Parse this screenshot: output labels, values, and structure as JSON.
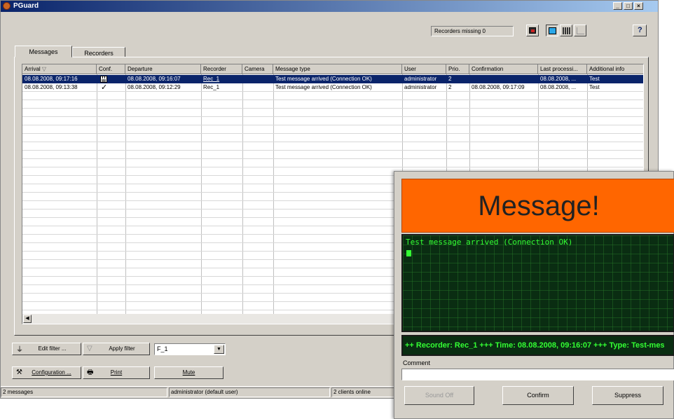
{
  "window": {
    "title": "PGuard",
    "controls": [
      "minimize-icon",
      "restore-icon",
      "close-icon"
    ]
  },
  "toolbar": {
    "recorders_missing": "Recorders missing 0",
    "help_label": "?"
  },
  "tabs": [
    {
      "label": "Messages",
      "active": true
    },
    {
      "label": "Recorders",
      "active": false
    }
  ],
  "grid": {
    "columns": [
      "Arrival",
      "Conf.",
      "Departure",
      "Recorder",
      "Camera",
      "Message type",
      "User",
      "Prio.",
      "Confirmation",
      "Last processi...",
      "Additional info"
    ],
    "rows": [
      {
        "arrival": "08.08.2008, 09:17:16",
        "conf": "lock",
        "departure": "08.08.2008, 09:16:07",
        "recorder": "Rec_1",
        "camera": "",
        "message_type": "Test message arrived (Connection OK)",
        "user": "administrator",
        "prio": "2",
        "confirmation": "",
        "last_processing": "08.08.2008, ...",
        "additional_info": "Test",
        "selected": true
      },
      {
        "arrival": "08.08.2008, 09:13:38",
        "conf": "✓",
        "departure": "08.08.2008, 09:12:29",
        "recorder": "Rec_1",
        "camera": "",
        "message_type": "Test message arrived (Connection OK)",
        "user": "administrator",
        "prio": "2",
        "confirmation": "08.08.2008, 09:17:09",
        "last_processing": "08.08.2008, ...",
        "additional_info": "Test",
        "selected": false
      }
    ]
  },
  "filter": {
    "edit_label": "Edit filter ...",
    "apply_label": "Apply filter",
    "selected": "F_1"
  },
  "actions": {
    "configuration_label": "Configuration ...",
    "print_label": "Print",
    "mute_label": "Mute"
  },
  "status": {
    "messages": "2 messages",
    "user": "administrator (default user)",
    "clients": "2 clients online"
  },
  "popup": {
    "banner": "Message!",
    "terminal_text": "Test message arrived (Connection OK)",
    "ticker": "++  Recorder: Rec_1 +++ Time: 08.08.2008, 09:16:07 +++ Type: Test-mes",
    "comment_label": "Comment",
    "comment_value": "",
    "sound_off_label": "Sound Off",
    "confirm_label": "Confirm",
    "suppress_label": "Suppress",
    "banner_color": "#ff6600",
    "terminal_color": "#33ff33"
  }
}
